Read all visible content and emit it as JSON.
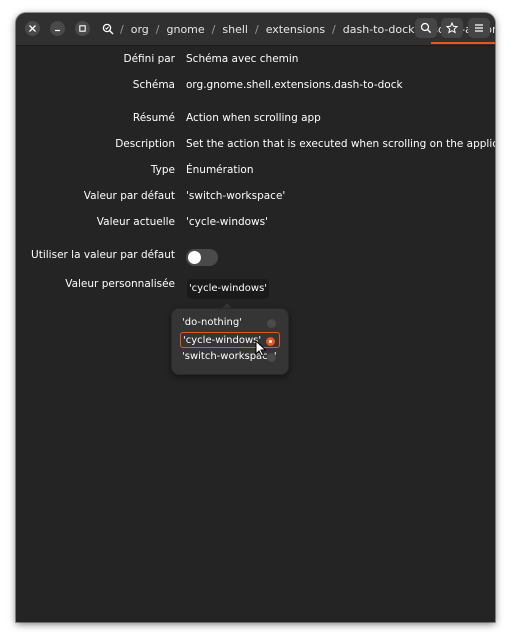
{
  "window": {
    "breadcrumbs": [
      "org",
      "gnome",
      "shell",
      "extensions",
      "dash-to-dock",
      "scroll-action"
    ]
  },
  "details": {
    "defined_by_label": "Défini par",
    "defined_by_value": "Schéma avec chemin",
    "schema_label": "Schéma",
    "schema_value": "org.gnome.shell.extensions.dash-to-dock",
    "summary_label": "Résumé",
    "summary_value": "Action when scrolling app",
    "description_label": "Description",
    "description_value": "Set the action that is executed when scrolling on the application icon",
    "type_label": "Type",
    "type_value": "Énumération",
    "default_label": "Valeur par défaut",
    "default_value": "'switch-workspace'",
    "current_label": "Valeur actuelle",
    "current_value": "'cycle-windows'"
  },
  "use_default": {
    "label": "Utiliser la valeur par défaut",
    "enabled": false
  },
  "custom_value": {
    "label": "Valeur personnalisée",
    "selected": "'cycle-windows'"
  },
  "options": [
    {
      "label": "'do-nothing'",
      "checked": false
    },
    {
      "label": "'cycle-windows'",
      "checked": true
    },
    {
      "label": "'switch-workspace'",
      "checked": false
    }
  ],
  "colors": {
    "accent": "#e95420",
    "background": "#242424",
    "headerbar": "#303030"
  }
}
